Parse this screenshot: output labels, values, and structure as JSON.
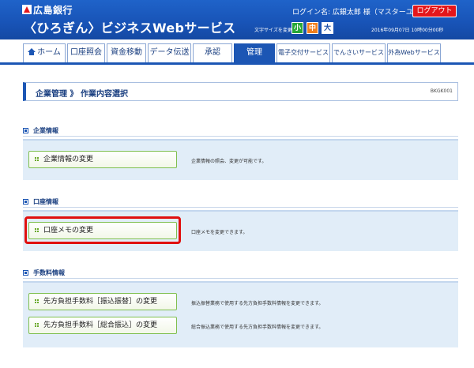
{
  "header": {
    "bank_name": "広島銀行",
    "service_name": "〈ひろぎん〉ビジネスWebサービス",
    "login_label": "ログイン名: 広銀太郎 様（マスターユーザ）",
    "logout_label": "ログアウト",
    "font_size_label": "文字サイズを変更",
    "font_small": "小",
    "font_medium": "中",
    "font_large": "大",
    "datetime": "2016年09月07日 10時00分00秒"
  },
  "nav": {
    "items": [
      {
        "label": "ホーム"
      },
      {
        "label": "口座照会"
      },
      {
        "label": "資金移動"
      },
      {
        "label": "データ伝送"
      },
      {
        "label": "承認"
      },
      {
        "label": "管理"
      },
      {
        "label": "電子交付サービス"
      },
      {
        "label": "でんさいサービス"
      },
      {
        "label": "外為Webサービス"
      }
    ],
    "active": "管理"
  },
  "page": {
    "title": "企業管理 》 作業内容選択",
    "screen_id": "BKGK001"
  },
  "sections": [
    {
      "title": "企業情報",
      "actions": [
        {
          "label": "企業情報の変更",
          "description": "企業情報の照会、変更が可能です。"
        }
      ]
    },
    {
      "title": "口座情報",
      "actions": [
        {
          "label": "口座メモの変更",
          "description": "口座メモを変更できます。"
        }
      ]
    },
    {
      "title": "手数料情報",
      "actions": [
        {
          "label": "先方負担手数料［振込振替］の変更",
          "description": "振込振替業務で使用する先方負担手数料情報を変更できます。"
        },
        {
          "label": "先方負担手数料［総合振込］の変更",
          "description": "総合振込業務で使用する先方負担手数料情報を変更できます。"
        }
      ]
    }
  ],
  "colors": {
    "header_blue": "#1853b6",
    "highlight_red": "#e01010",
    "section_bg": "#e1edf8"
  }
}
